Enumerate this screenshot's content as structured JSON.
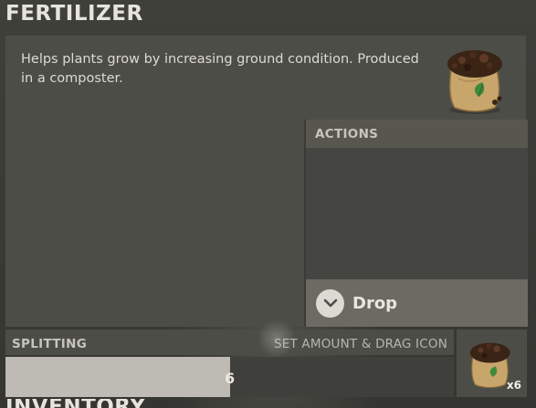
{
  "item": {
    "title": "FERTILIZER",
    "description": "Helps plants grow by increasing ground condition. Produced in a composter.",
    "icon": "fertilizer-sack-icon"
  },
  "actions": {
    "header": "ACTIONS",
    "drop_label": "Drop",
    "drop_icon": "chevron-down-icon"
  },
  "splitting": {
    "title": "SPLITTING",
    "hint": "SET AMOUNT & DRAG ICON",
    "value": "6",
    "fill_fraction": 0.5
  },
  "stack": {
    "count": "x6",
    "icon": "fertilizer-sack-icon"
  },
  "next_section_title": "INVENTORY"
}
